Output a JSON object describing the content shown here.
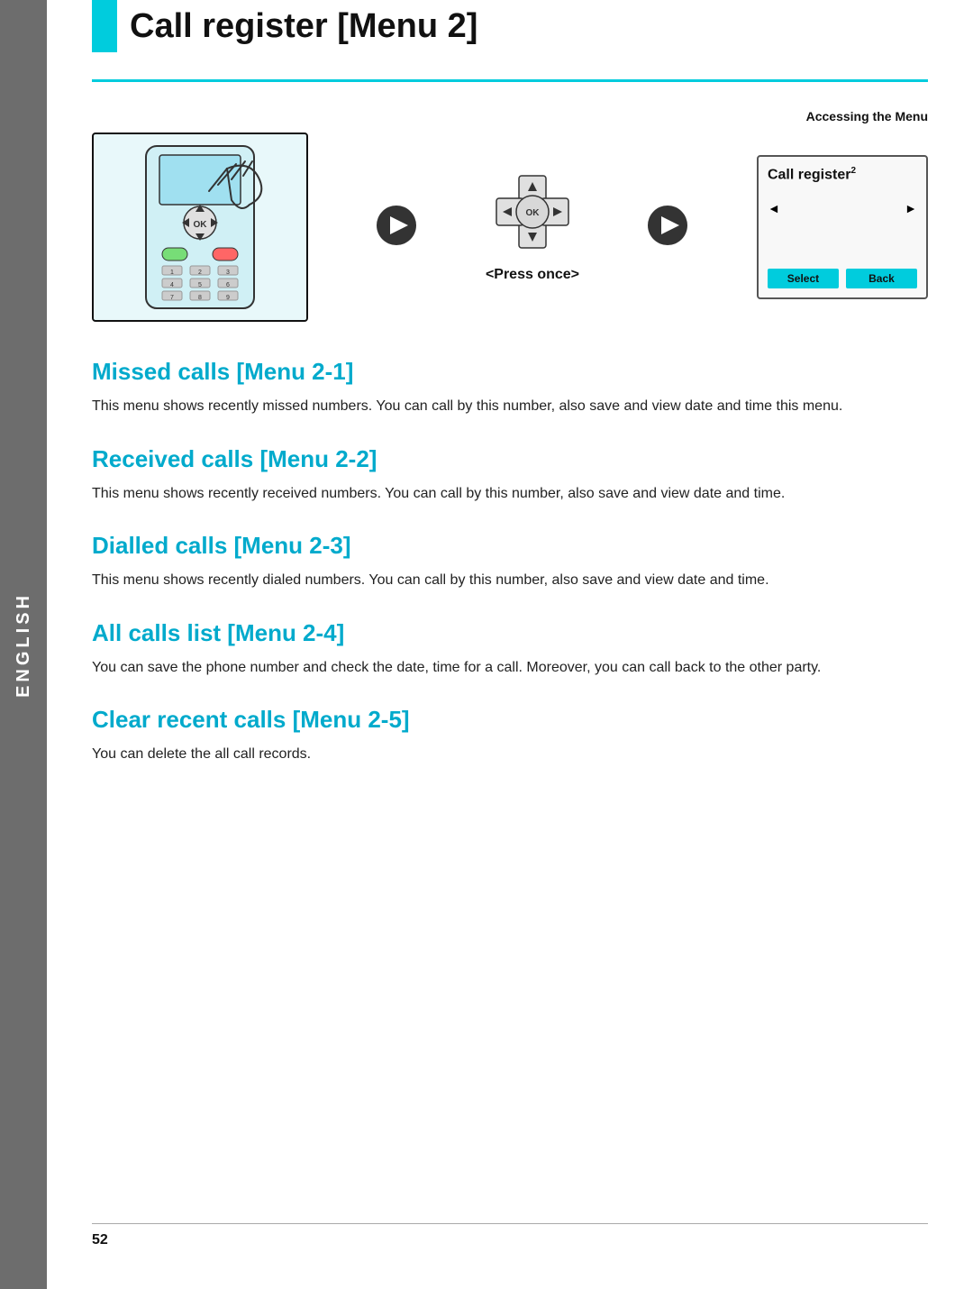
{
  "sidebar": {
    "text": "ENGLISH"
  },
  "header": {
    "title": "Call register [Menu 2]",
    "accessing_label": "Accessing the Menu"
  },
  "diagram": {
    "press_once": "<Press once>",
    "screen": {
      "title": "Call register",
      "superscript": "2",
      "left_arrow": "◄",
      "right_arrow": "►",
      "btn_select": "Select",
      "btn_back": "Back"
    }
  },
  "sections": [
    {
      "heading": "Missed calls [Menu 2-1]",
      "body": "This menu shows recently missed numbers. You can call by this number, also save and view date and time this menu."
    },
    {
      "heading": "Received calls [Menu 2-2]",
      "body": "This menu shows recently received numbers. You can call by this number, also save and view date and time."
    },
    {
      "heading": "Dialled calls [Menu 2-3]",
      "body": "This menu shows recently dialed numbers. You can call by this number, also save and view date and time."
    },
    {
      "heading": "All calls list [Menu 2-4]",
      "body": "You can save the phone number and check the date, time for a call. Moreover, you can call back to the other party."
    },
    {
      "heading": "Clear recent calls [Menu 2-5]",
      "body": "You can delete the all call records."
    }
  ],
  "page_number": "52"
}
